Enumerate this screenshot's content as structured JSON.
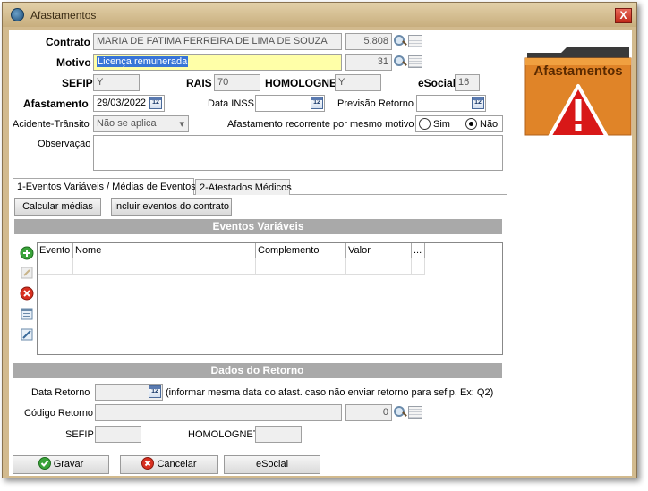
{
  "window": {
    "title": "Afastamentos",
    "close_label": "X"
  },
  "form": {
    "contrato_label": "Contrato",
    "contrato_value": "MARIA DE FATIMA FERREIRA DE LIMA DE SOUZA",
    "contrato_code": "5.808",
    "motivo_label": "Motivo",
    "motivo_value": "Licença remunerada",
    "motivo_code": "31",
    "sefip_label": "SEFIP",
    "sefip_value": "Y",
    "rais_label": "RAIS",
    "rais_value": "70",
    "homolognet_label": "HOMOLOGNET",
    "homolognet_value": "Y",
    "esocial_label": "eSocial",
    "esocial_value": "16",
    "afastamento_label": "Afastamento",
    "afastamento_value": "29/03/2022",
    "data_inss_label": "Data INSS",
    "data_inss_value": "",
    "previsao_label": "Previsão Retorno",
    "previsao_value": "",
    "acidente_label": "Acidente-Trânsito",
    "acidente_value": "Não se aplica",
    "recorrente_label": "Afastamento recorrente por mesmo motivo",
    "radio_sim": "Sim",
    "radio_nao": "Não",
    "observacao_label": "Observação",
    "calendar_glyph": "12"
  },
  "side_image": {
    "text": "Afastamentos"
  },
  "tabs": [
    {
      "label": "1-Eventos Variáveis / Médias de Eventos",
      "active": true
    },
    {
      "label": "2-Atestados Médicos",
      "active": false
    }
  ],
  "eventos": {
    "calcular_medias_label": "Calcular médias",
    "incluir_eventos_label": "Incluir eventos do contrato",
    "section_title": "Eventos Variáveis",
    "columns": [
      "Evento",
      "Nome",
      "Complemento",
      "Valor",
      "..."
    ]
  },
  "retorno": {
    "section_title": "Dados do Retorno",
    "data_retorno_label": "Data Retorno",
    "data_retorno_hint": "(informar mesma data do afast. caso não enviar retorno para sefip. Ex: Q2)",
    "codigo_retorno_label": "Código Retorno",
    "codigo_retorno_code": "0",
    "sefip_label": "SEFIP",
    "homolognet_label": "HOMOLOGNET"
  },
  "footer": {
    "gravar_label": "Gravar",
    "cancelar_label": "Cancelar",
    "esocial_label": "eSocial"
  },
  "colors": {
    "window_frame": "#d2ba8e",
    "folder": "#e08428",
    "warning_red": "#d81818",
    "section_header": "#a9a9a9",
    "highlight_field": "#ffffa8"
  }
}
